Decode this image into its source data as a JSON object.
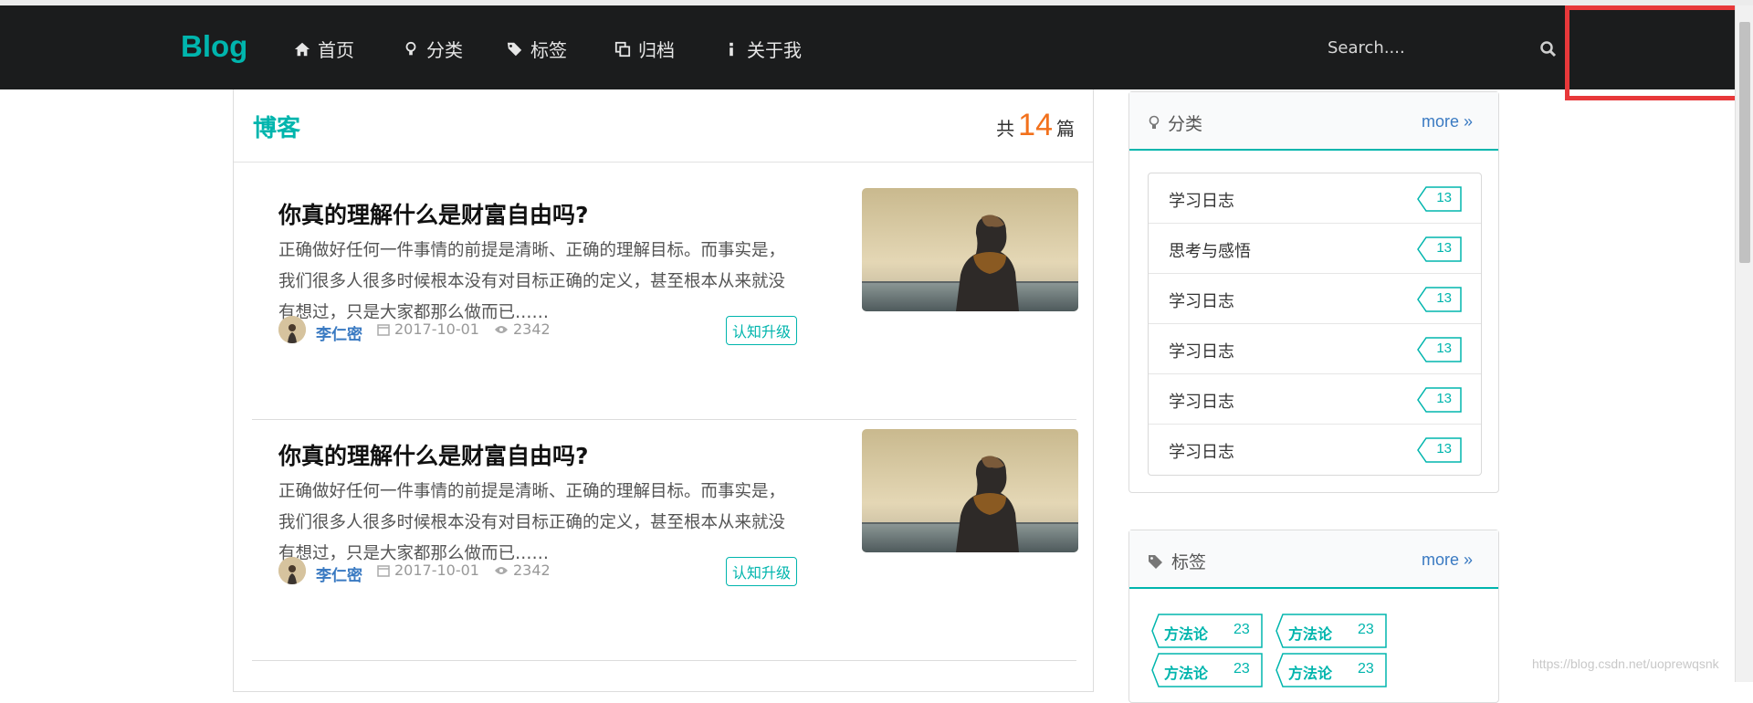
{
  "nav": {
    "brand": "Blog",
    "items": [
      {
        "label": "首页",
        "icon": "home-icon"
      },
      {
        "label": "分类",
        "icon": "lightbulb-icon"
      },
      {
        "label": "标签",
        "icon": "tags-icon"
      },
      {
        "label": "归档",
        "icon": "clone-icon"
      },
      {
        "label": "关于我",
        "icon": "info-icon"
      }
    ],
    "search_placeholder": "Search....",
    "accent_color": "#00b5ad",
    "highlight_color": "#e8383a"
  },
  "main": {
    "title": "博客",
    "count_prefix": "共",
    "count": "14",
    "count_suffix": "篇",
    "posts": [
      {
        "title": "你真的理解什么是财富自由吗?",
        "excerpt": "正确做好任何一件事情的前提是清晰、正确的理解目标。而事实是，我们很多人很多时候根本没有对目标正确的定义，甚至根本从来就没有想过，只是大家都那么做而已……",
        "author": "李仁密",
        "date": "2017-10-01",
        "views": "2342",
        "tag": "认知升级"
      },
      {
        "title": "你真的理解什么是财富自由吗?",
        "excerpt": "正确做好任何一件事情的前提是清晰、正确的理解目标。而事实是，我们很多人很多时候根本没有对目标正确的定义，甚至根本从来就没有想过，只是大家都那么做而已……",
        "author": "李仁密",
        "date": "2017-10-01",
        "views": "2342",
        "tag": "认知升级"
      }
    ]
  },
  "sidebar": {
    "categories": {
      "title": "分类",
      "more": "more",
      "items": [
        {
          "name": "学习日志",
          "count": "13"
        },
        {
          "name": "思考与感悟",
          "count": "13"
        },
        {
          "name": "学习日志",
          "count": "13"
        },
        {
          "name": "学习日志",
          "count": "13"
        },
        {
          "name": "学习日志",
          "count": "13"
        },
        {
          "name": "学习日志",
          "count": "13"
        }
      ]
    },
    "tags": {
      "title": "标签",
      "more": "more",
      "items": [
        {
          "name": "方法论",
          "count": "23"
        },
        {
          "name": "方法论",
          "count": "23"
        },
        {
          "name": "方法论",
          "count": "23"
        },
        {
          "name": "方法论",
          "count": "23"
        }
      ]
    }
  },
  "watermark": "https://blog.csdn.net/uoprewqsnk"
}
